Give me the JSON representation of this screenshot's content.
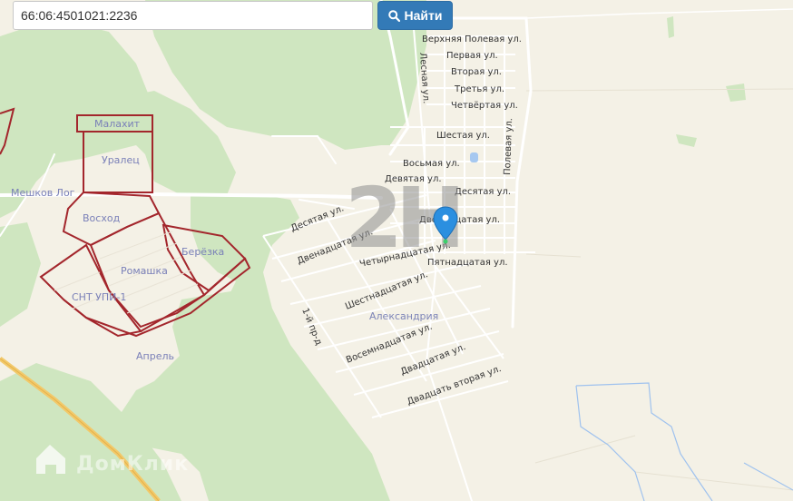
{
  "search": {
    "value": "66:06:4501021:2236",
    "button_label": "Найти",
    "button_icon": "search-icon"
  },
  "watermarks": {
    "map_brand": "2H",
    "site_brand": "ДомКлик"
  },
  "plots": {
    "malakhit": "Малахит",
    "uralets": "Уралец",
    "voskhod": "Восход",
    "beryozka": "Берёзка",
    "romashka": "Ромашка",
    "snt_upi": "СНТ УПИ-1"
  },
  "places": {
    "meshkov_log": "Мешков Лог",
    "aprel": "Апрель",
    "aleksandriya": "Александрия"
  },
  "streets": {
    "verkhnyaya_polevaya": "Верхняя Полевая ул.",
    "pervaya": "Первая ул.",
    "vtoraya": "Вторая ул.",
    "tretya": "Третья ул.",
    "chetvyortaya": "Четвёртая ул.",
    "shestaya": "Шестая ул.",
    "vosmaya": "Восьмая ул.",
    "devyataya": "Девятая ул.",
    "desyataya_east": "Десятая ул.",
    "desyataya_west": "Десятая ул.",
    "dvenadtsataya_east": "Двенадцатая ул.",
    "dvenadtsataya_west": "Двенадцатая ул.",
    "chetyrnadtsataya": "Четырнадцатая ул.",
    "pyatnadtsataya": "Пятнадцатая ул.",
    "shestnadtsataya": "Шестнадцатая ул.",
    "vosemnadtsataya": "Восемнадцатая ул.",
    "dvadtsataya": "Двадцатая ул.",
    "dvadtsat_vtoraya": "Двадцать вторая ул.",
    "lesnaya": "Лесная ул.",
    "polevaya": "Полевая ул.",
    "first_passage": "1-й пр-д"
  },
  "colors": {
    "forest": "#cfe6c0",
    "land": "#f4f1e6",
    "plot_border": "#a3262c",
    "road": "#ffffff",
    "highway": "#f2c96a",
    "water": "#a6c8f0",
    "marker": "#2b8fe0",
    "button": "#337ab7"
  },
  "marker": {
    "icon": "map-pin-icon",
    "point_color": "#3ccf6b"
  }
}
